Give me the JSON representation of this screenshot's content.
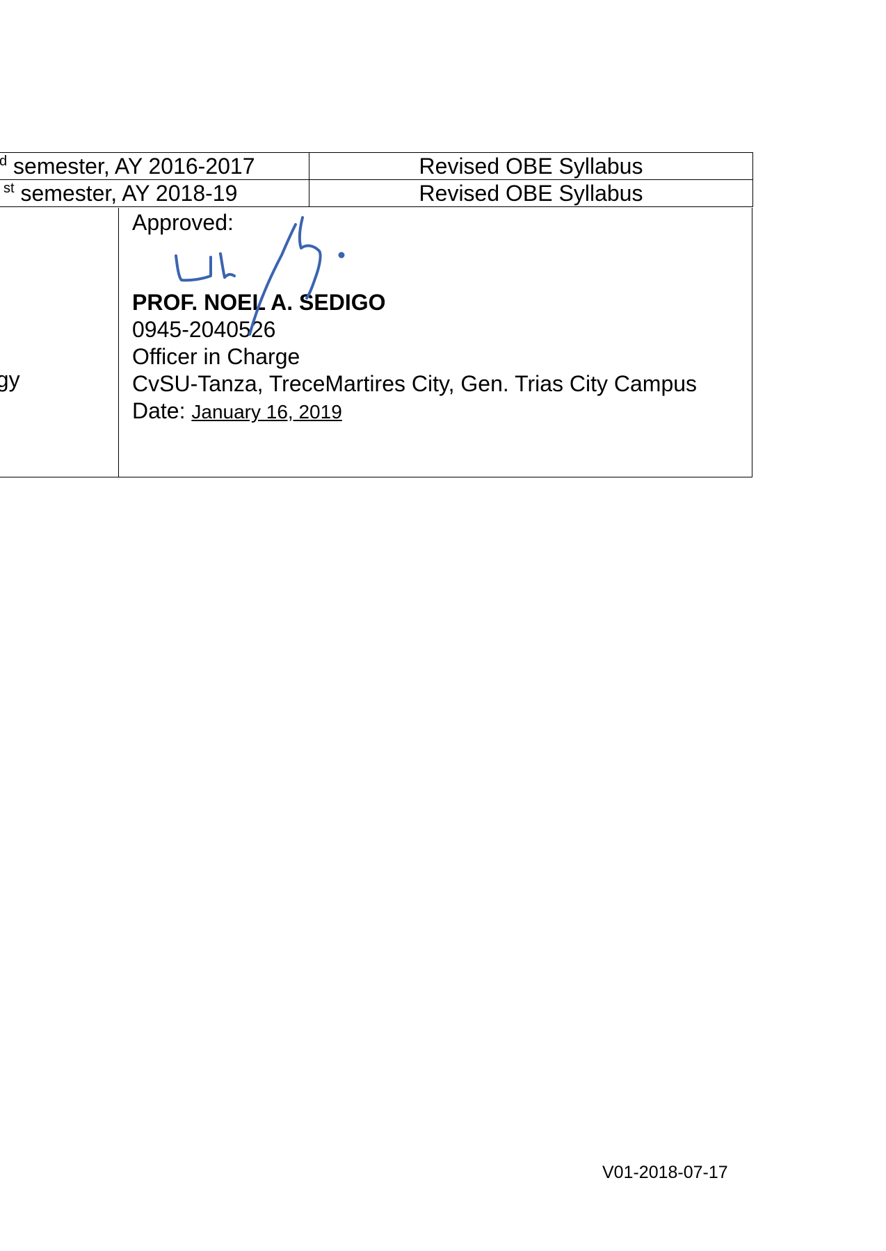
{
  "revisions": [
    {
      "sup": "d",
      "period": " semester, AY 2016-2017",
      "description": "Revised OBE Syllabus"
    },
    {
      "sup": "st",
      "period": " semester, AY 2018-19",
      "description": "Revised OBE Syllabus"
    }
  ],
  "approval": {
    "left_fragment": "ogy",
    "label": "Approved:",
    "name": "PROF. NOEL A. SEDIGO",
    "phone": "0945-2040526",
    "title": "Officer in Charge",
    "campus": "CvSU-Tanza, TreceMartires City, Gen. Trias City Campus",
    "date_label": "Date: ",
    "date_value": "January 16, 2019"
  },
  "footer": {
    "version_code": "V01-2018-07-17"
  },
  "colors": {
    "signature_ink": "#3b64b0",
    "text": "#000000",
    "border": "#000000"
  }
}
